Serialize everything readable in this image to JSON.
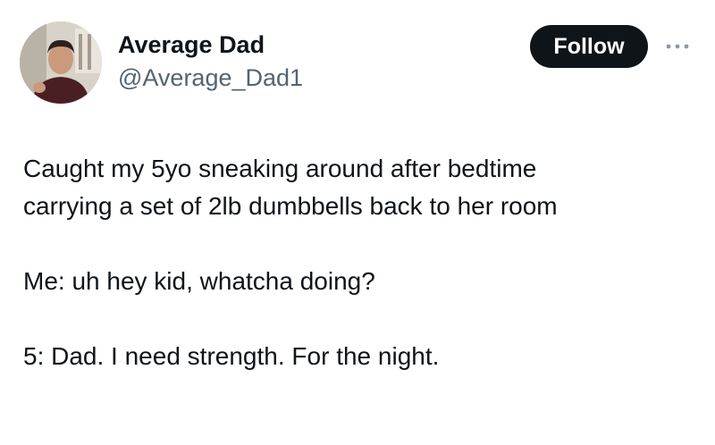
{
  "author": {
    "display_name": "Average Dad",
    "handle": "@Average_Dad1",
    "avatar_icon": "profile-photo"
  },
  "actions": {
    "follow_label": "Follow",
    "more_icon": "more-dots-icon"
  },
  "tweet": {
    "lines": [
      "Caught my 5yo sneaking around after bedtime",
      "carrying a set of 2lb dumbbells back to her room",
      "",
      "Me: uh hey kid, whatcha doing?",
      "",
      "5: Dad. I need strength. For the night."
    ]
  },
  "colors": {
    "text_primary": "#0f1419",
    "text_secondary": "#536471",
    "button_bg": "#0f1419",
    "button_text": "#ffffff"
  }
}
